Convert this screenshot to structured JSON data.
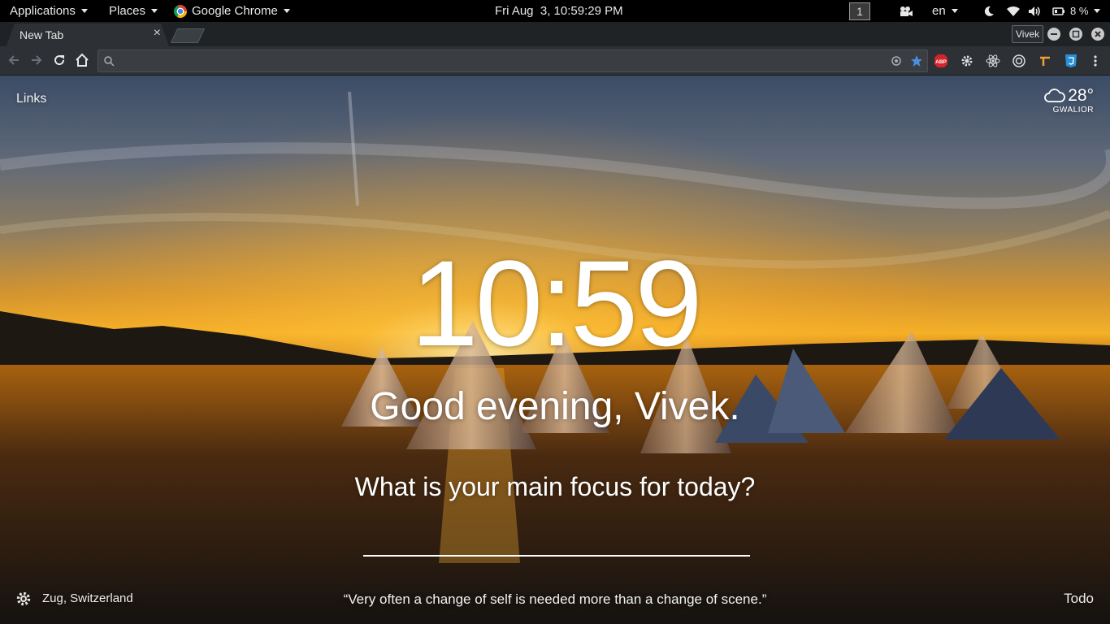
{
  "topbar": {
    "applications_label": "Applications",
    "places_label": "Places",
    "app_label": "Google Chrome",
    "clock": "Fri Aug  3, 10:59:29 PM",
    "workspace": "1",
    "keyboard_layout": "en",
    "battery": "8 %"
  },
  "browser": {
    "tab_title": "New Tab",
    "tab_close": "×",
    "profile_name": "Vivek",
    "omnibox_value": "",
    "extensions": [
      "abp-icon",
      "gear-extension-icon",
      "react-icon",
      "target-icon",
      "tools-icon",
      "css3-icon",
      "menu-icon"
    ],
    "abp_label": "ABP",
    "accent": "#4a90e2"
  },
  "momentum": {
    "links_label": "Links",
    "temperature": "28°",
    "city": "GWALIOR",
    "time": "10:59",
    "greeting": "Good evening, Vivek.",
    "focus_question": "What is your main focus for today?",
    "focus_value": "",
    "location": "Zug, Switzerland",
    "quote": "“Very often a change of self is needed more than a change of scene.”",
    "todo_label": "Todo"
  }
}
